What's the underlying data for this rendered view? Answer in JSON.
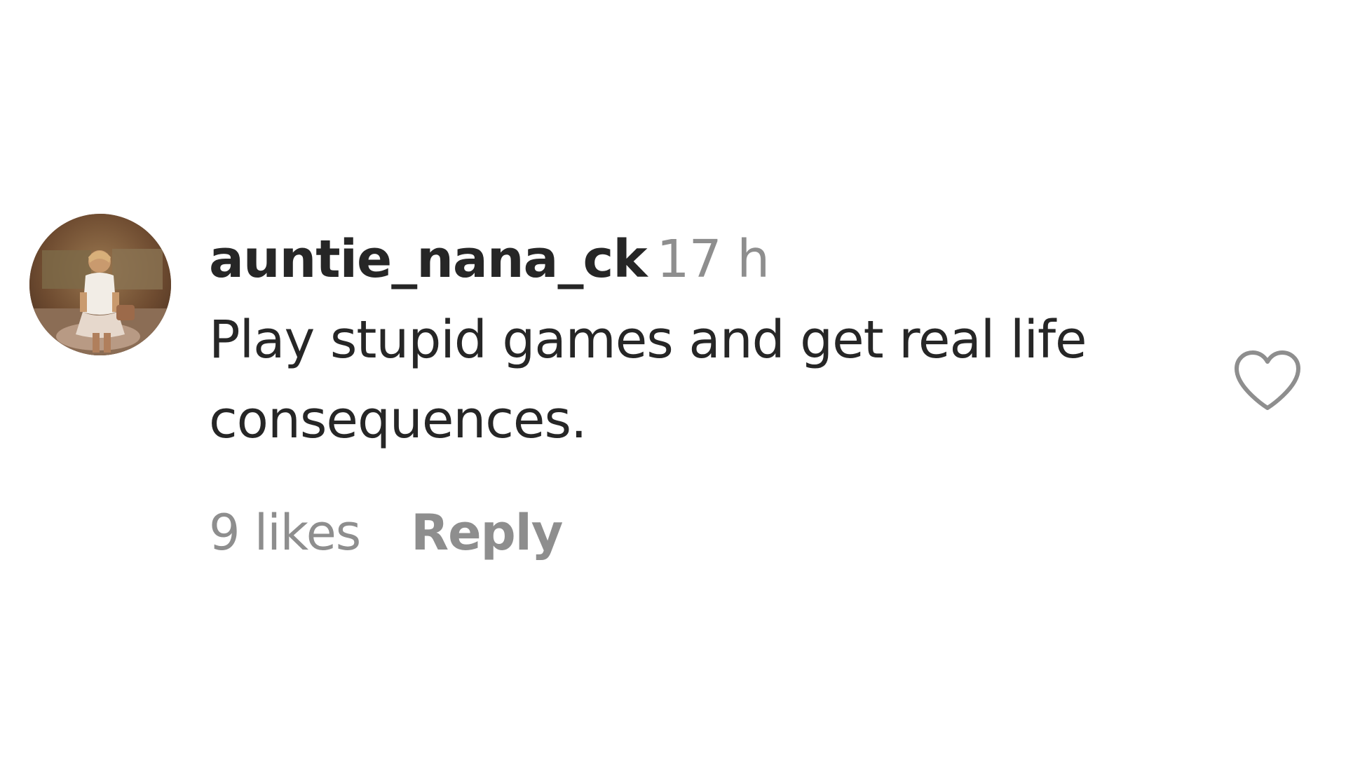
{
  "comment": {
    "username": "auntie_nana_ck",
    "timestamp": "17 h",
    "text": "Play stupid games and get real life consequences.",
    "likes": "9 likes",
    "reply_label": "Reply",
    "like_icon": "heart-outline-icon"
  }
}
